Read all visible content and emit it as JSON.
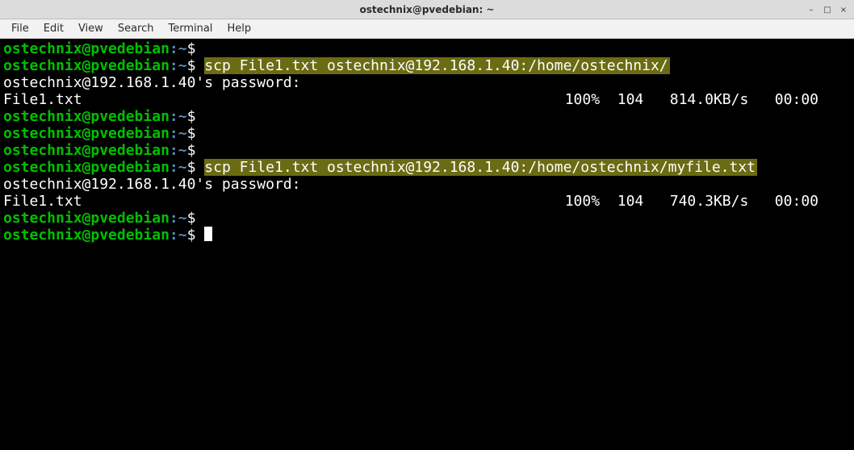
{
  "window": {
    "title": "ostechnix@pvedebian: ~"
  },
  "titlebar_buttons": {
    "minimize": "–",
    "maximize": "□",
    "close": "×"
  },
  "menu": {
    "file": "File",
    "edit": "Edit",
    "view": "View",
    "search": "Search",
    "terminal": "Terminal",
    "help": "Help"
  },
  "prompt": {
    "user_host": "ostechnix@pvedebian",
    "sep": ":",
    "path": "~",
    "symbol": "$"
  },
  "lines": {
    "cmd1": "scp File1.txt ostechnix@192.168.1.40:/home/ostechnix/",
    "pwprompt": "ostechnix@192.168.1.40's password:",
    "xfer1_file": "File1.txt",
    "xfer1_stats": "100%  104   814.0KB/s   00:00",
    "cmd2": "scp File1.txt ostechnix@192.168.1.40:/home/ostechnix/myfile.txt",
    "xfer2_file": "File1.txt",
    "xfer2_stats": "100%  104   740.3KB/s   00:00"
  }
}
